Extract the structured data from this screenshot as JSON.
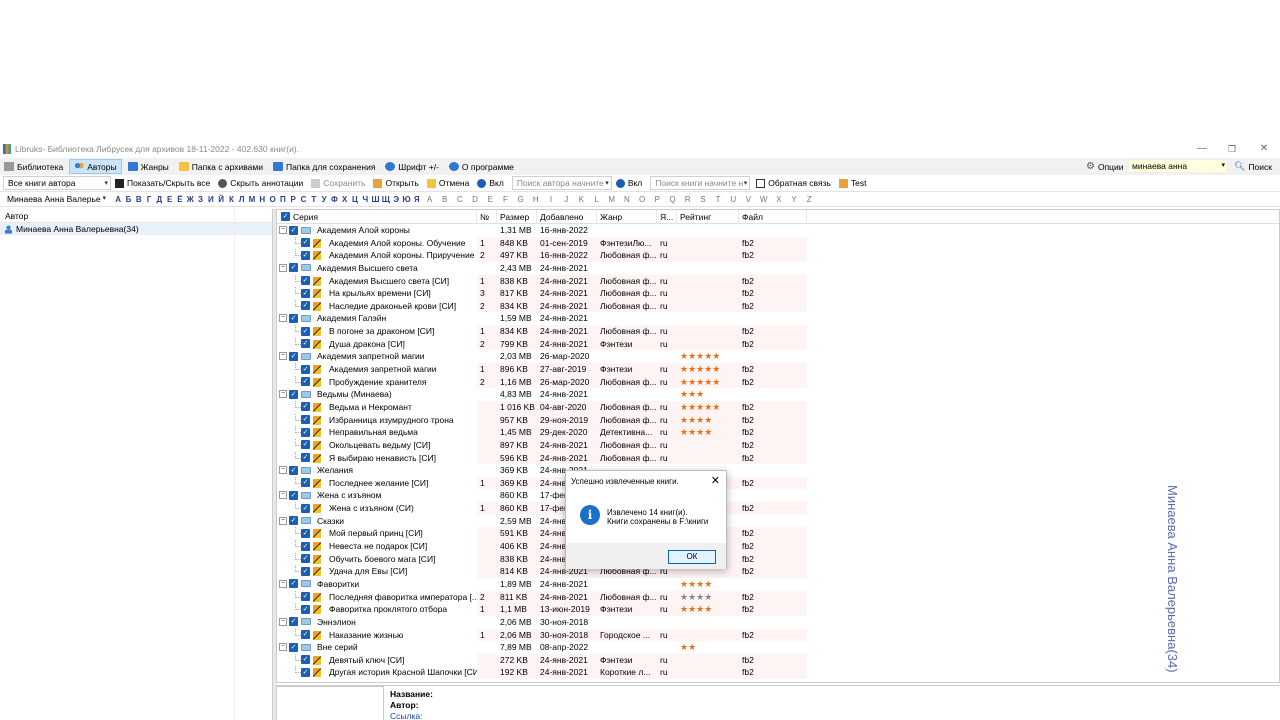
{
  "window": {
    "app_name": "Libruks",
    "title_rest": " - Библиотека Либрусек для архивов 18-11-2022 - 402.630 книг(и).",
    "minimize": "—",
    "maximize": "❐",
    "close": "✕"
  },
  "menu": {
    "library": "Библиотека",
    "authors": "Авторы",
    "genres": "Жанры",
    "archive_folder": "Папка с архивами",
    "save_folder": "Папка для сохранения",
    "font": "Шрифт +/-",
    "about": "О программе",
    "options": "Опции",
    "search_value": "минаева анна",
    "search": "Поиск"
  },
  "toolbar": {
    "author_books": "Все книги автора",
    "show_hide_all": "Показать/Скрыть все",
    "hide_annotations": "Скрыть аннотации",
    "save": "Сохранить",
    "open": "Открыть",
    "cancel": "Отмена",
    "on1": "Вкл",
    "author_search_placeholder": "Поиск автора начните",
    "on2": "Вкл",
    "book_search_placeholder": "Поиск книги начните н",
    "feedback": "Обратная связь",
    "test": "Test",
    "author_combo": "Минаева Анна Валерье"
  },
  "alphabet_cyr": [
    "А",
    "Б",
    "В",
    "Г",
    "Д",
    "Е",
    "Ё",
    "Ж",
    "З",
    "И",
    "Й",
    "К",
    "Л",
    "М",
    "Н",
    "О",
    "П",
    "Р",
    "С",
    "Т",
    "У",
    "Ф",
    "Х",
    "Ц",
    "Ч",
    "Ш",
    "Щ",
    "Э",
    "Ю",
    "Я"
  ],
  "alphabet_lat": [
    "A",
    "B",
    "C",
    "D",
    "E",
    "F",
    "G",
    "H",
    "I",
    "J",
    "K",
    "L",
    "M",
    "N",
    "O",
    "P",
    "Q",
    "R",
    "S",
    "T",
    "U",
    "V",
    "W",
    "X",
    "Y",
    "Z"
  ],
  "left": {
    "header": "Автор",
    "author": "Минаева Анна Валерьевна(34)"
  },
  "grid": {
    "columns": [
      "Серия",
      "№",
      "Размер",
      "Добавлено",
      "Жанр",
      "Я...",
      "Рейтинг",
      "Файл"
    ],
    "rows": [
      {
        "t": "s",
        "title": "Академия Алой короны",
        "num": "",
        "size": "1,31 MB",
        "date": "16-янв-2022",
        "genre": "",
        "lang": "",
        "rating": 0,
        "file": ""
      },
      {
        "t": "b",
        "title": "Академия Алой короны. Обучение",
        "num": "1",
        "size": "848 KB",
        "date": "01-сен-2019",
        "genre": "ФэнтезиЛю...",
        "lang": "ru",
        "rating": 0,
        "file": "fb2"
      },
      {
        "t": "b",
        "title": "Академия Алой короны. Приручение",
        "num": "2",
        "size": "497 KB",
        "date": "16-янв-2022",
        "genre": "Любовная ф...",
        "lang": "ru",
        "rating": 0,
        "file": "fb2"
      },
      {
        "t": "s",
        "title": "Академия Высшего света",
        "num": "",
        "size": "2,43 MB",
        "date": "24-янв-2021",
        "genre": "",
        "lang": "",
        "rating": 0,
        "file": ""
      },
      {
        "t": "b",
        "title": "Академия Высшего света [СИ]",
        "num": "1",
        "size": "838 KB",
        "date": "24-янв-2021",
        "genre": "Любовная ф...",
        "lang": "ru",
        "rating": 0,
        "file": "fb2"
      },
      {
        "t": "b",
        "title": "На крыльях времени [СИ]",
        "num": "3",
        "size": "817 KB",
        "date": "24-янв-2021",
        "genre": "Любовная ф...",
        "lang": "ru",
        "rating": 0,
        "file": "fb2"
      },
      {
        "t": "b",
        "title": "Наследие драконьей крови [СИ]",
        "num": "2",
        "size": "834 KB",
        "date": "24-янв-2021",
        "genre": "Любовная ф...",
        "lang": "ru",
        "rating": 0,
        "file": "fb2"
      },
      {
        "t": "s",
        "title": "Академия Галэйн",
        "num": "",
        "size": "1,59 MB",
        "date": "24-янв-2021",
        "genre": "",
        "lang": "",
        "rating": 0,
        "file": ""
      },
      {
        "t": "b",
        "title": "В погоне за драконом [СИ]",
        "num": "1",
        "size": "834 KB",
        "date": "24-янв-2021",
        "genre": "Любовная ф...",
        "lang": "ru",
        "rating": 0,
        "file": "fb2"
      },
      {
        "t": "b",
        "title": "Душа дракона [СИ]",
        "num": "2",
        "size": "799 KB",
        "date": "24-янв-2021",
        "genre": "Фэнтези",
        "lang": "ru",
        "rating": 0,
        "file": "fb2"
      },
      {
        "t": "s",
        "title": "Академия запретной магии",
        "num": "",
        "size": "2,03 MB",
        "date": "26-мар-2020",
        "genre": "",
        "lang": "",
        "rating": 5,
        "file": ""
      },
      {
        "t": "b",
        "title": "Академия запретной магии",
        "num": "1",
        "size": "896 KB",
        "date": "27-авг-2019",
        "genre": "Фэнтези",
        "lang": "ru",
        "rating": 5,
        "file": "fb2"
      },
      {
        "t": "b",
        "title": "Пробуждение хранителя",
        "num": "2",
        "size": "1,16 MB",
        "date": "26-мар-2020",
        "genre": "Любовная ф...",
        "lang": "ru",
        "rating": 5,
        "file": "fb2"
      },
      {
        "t": "s",
        "title": "Ведьмы (Минаева)",
        "num": "",
        "size": "4,83 MB",
        "date": "24-янв-2021",
        "genre": "",
        "lang": "",
        "rating": 3,
        "file": ""
      },
      {
        "t": "b",
        "title": "Ведьма и Некромант",
        "num": "",
        "size": "1 016 KB",
        "date": "04-авг-2020",
        "genre": "Любовная ф...",
        "lang": "ru",
        "rating": 5,
        "file": "fb2"
      },
      {
        "t": "b",
        "title": "Избранница изумрудного трона",
        "num": "",
        "size": "957 KB",
        "date": "29-ноя-2019",
        "genre": "Любовная ф...",
        "lang": "ru",
        "rating": 4,
        "file": "fb2"
      },
      {
        "t": "b",
        "title": "Неправильная ведьма",
        "num": "",
        "size": "1,45 MB",
        "date": "29-дек-2020",
        "genre": "Детективна...",
        "lang": "ru",
        "rating": 4,
        "file": "fb2"
      },
      {
        "t": "b",
        "title": "Окольцевать ведьму [СИ]",
        "num": "",
        "size": "897 KB",
        "date": "24-янв-2021",
        "genre": "Любовная ф...",
        "lang": "ru",
        "rating": 0,
        "file": "fb2"
      },
      {
        "t": "b",
        "title": "Я выбираю ненависть [СИ]",
        "num": "",
        "size": "596 KB",
        "date": "24-янв-2021",
        "genre": "Любовная ф...",
        "lang": "ru",
        "rating": 0,
        "file": "fb2"
      },
      {
        "t": "s",
        "title": "Желания",
        "num": "",
        "size": "369 KB",
        "date": "24-янв-2021",
        "genre": "",
        "lang": "",
        "rating": 0,
        "file": ""
      },
      {
        "t": "b",
        "title": "Последнее желание [СИ]",
        "num": "1",
        "size": "369 KB",
        "date": "24-янв-2021",
        "genre": "",
        "lang": "",
        "rating": 0,
        "file": "fb2"
      },
      {
        "t": "s",
        "title": "Жена с изъяном",
        "num": "",
        "size": "860 KB",
        "date": "17-фев-2021",
        "genre": "",
        "lang": "",
        "rating": 0,
        "file": ""
      },
      {
        "t": "b",
        "title": "Жена с изъяном (СИ)",
        "num": "1",
        "size": "860 KB",
        "date": "17-фев-2021",
        "genre": "",
        "lang": "",
        "rating": 0,
        "file": "fb2"
      },
      {
        "t": "s",
        "title": "Сказки",
        "num": "",
        "size": "2,59 MB",
        "date": "24-янв-2021",
        "genre": "",
        "lang": "",
        "rating": 0,
        "file": ""
      },
      {
        "t": "b",
        "title": "Мой первый принц  [СИ]",
        "num": "",
        "size": "591 KB",
        "date": "24-янв-2021",
        "genre": "",
        "lang": "",
        "rating": 0,
        "file": "fb2"
      },
      {
        "t": "b",
        "title": "Невеста не подарок [СИ]",
        "num": "",
        "size": "406 KB",
        "date": "24-янв-2021",
        "genre": "",
        "lang": "",
        "rating": 0,
        "file": "fb2"
      },
      {
        "t": "b",
        "title": "Обучить боевого мага [СИ]",
        "num": "",
        "size": "838 KB",
        "date": "24-янв-2021",
        "genre": "",
        "lang": "",
        "rating": 0,
        "file": "fb2"
      },
      {
        "t": "b",
        "title": "Удача для Евы [СИ]",
        "num": "",
        "size": "814 KB",
        "date": "24-янв-2021",
        "genre": "Любовная ф...",
        "lang": "ru",
        "rating": 0,
        "file": "fb2"
      },
      {
        "t": "s",
        "title": "Фаворитки",
        "num": "",
        "size": "1,89 MB",
        "date": "24-янв-2021",
        "genre": "",
        "lang": "",
        "rating": 4,
        "file": ""
      },
      {
        "t": "b",
        "title": "Последняя фаворитка императора [...",
        "num": "2",
        "size": "811 KB",
        "date": "24-янв-2021",
        "genre": "Любовная ф...",
        "lang": "ru",
        "rating": -4,
        "file": "fb2"
      },
      {
        "t": "b",
        "title": "Фаворитка проклятого отбора",
        "num": "1",
        "size": "1,1 MB",
        "date": "13-июн-2019",
        "genre": "Фэнтези",
        "lang": "ru",
        "rating": 4,
        "file": "fb2"
      },
      {
        "t": "s",
        "title": "Эннэлион",
        "num": "",
        "size": "2,06 MB",
        "date": "30-ноя-2018",
        "genre": "",
        "lang": "",
        "rating": 0,
        "file": ""
      },
      {
        "t": "b",
        "title": "Наказание жизнью",
        "num": "1",
        "size": "2,06 MB",
        "date": "30-ноя-2018",
        "genre": "Городское ...",
        "lang": "ru",
        "rating": 0,
        "file": "fb2"
      },
      {
        "t": "s",
        "title": "Вне серий",
        "num": "",
        "size": "7,89 MB",
        "date": "08-апр-2022",
        "genre": "",
        "lang": "",
        "rating": 2,
        "file": ""
      },
      {
        "t": "b",
        "title": "Девятый ключ [СИ]",
        "num": "",
        "size": "272 KB",
        "date": "24-янв-2021",
        "genre": "Фэнтези",
        "lang": "ru",
        "rating": 0,
        "file": "fb2"
      },
      {
        "t": "b",
        "title": "Другая история Красной Шапочки [СИ]",
        "num": "",
        "size": "192 KB",
        "date": "24-янв-2021",
        "genre": "Короткие л...",
        "lang": "ru",
        "rating": 0,
        "file": "fb2"
      }
    ]
  },
  "vertical_name": "Минаева Анна Валерьевна(34)",
  "info": {
    "name_label": "Название:",
    "author_label": "Автор:",
    "link_label": "Ссылка:"
  },
  "dialog": {
    "title": "Успешно извлеченные книги.",
    "close": "✕",
    "line1": "Извлечено 14 книг(и).",
    "line2": "Книги сохранены в F:\\книги",
    "ok": "ОК"
  }
}
